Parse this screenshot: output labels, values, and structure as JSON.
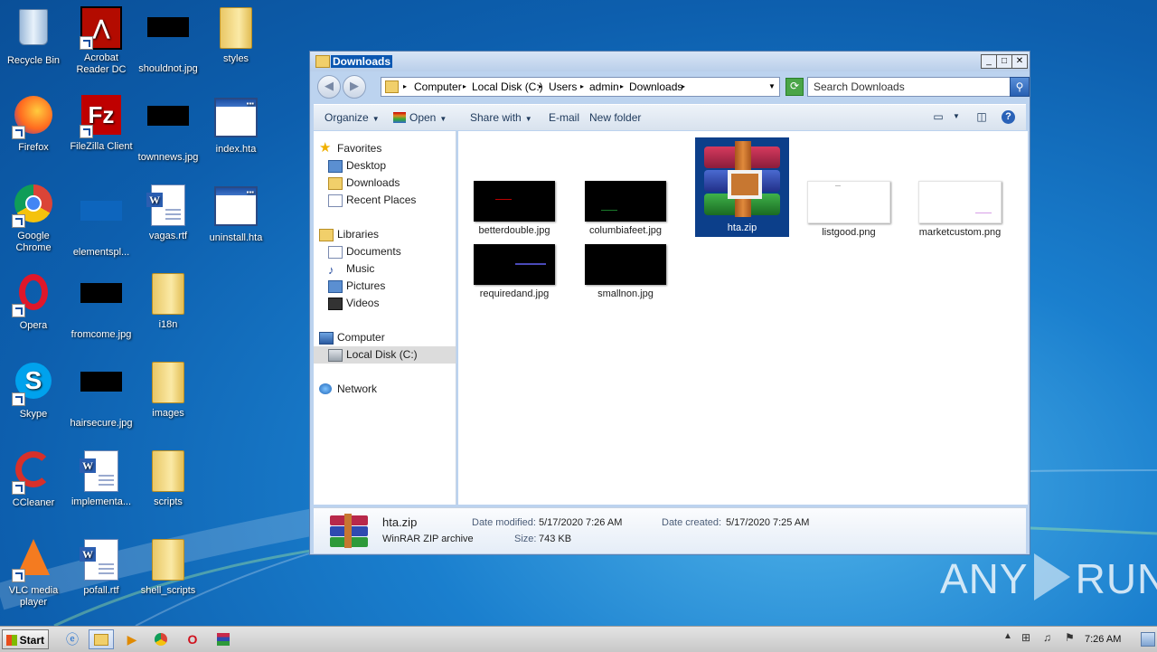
{
  "desktop": {
    "icons": [
      {
        "label": "Recycle Bin"
      },
      {
        "label": "Acrobat Reader DC"
      },
      {
        "label": "shouldnot.jpg"
      },
      {
        "label": "styles"
      },
      {
        "label": "Firefox"
      },
      {
        "label": "FileZilla Client"
      },
      {
        "label": "townnews.jpg"
      },
      {
        "label": "index.hta"
      },
      {
        "label": "Google Chrome"
      },
      {
        "label": "elementspl..."
      },
      {
        "label": "vagas.rtf"
      },
      {
        "label": "uninstall.hta"
      },
      {
        "label": "Opera"
      },
      {
        "label": "fromcome.jpg"
      },
      {
        "label": "i18n"
      },
      {
        "label": "Skype"
      },
      {
        "label": "hairsecure.jpg"
      },
      {
        "label": "images"
      },
      {
        "label": "CCleaner"
      },
      {
        "label": "implementa..."
      },
      {
        "label": "scripts"
      },
      {
        "label": "VLC media player"
      },
      {
        "label": "pofall.rtf"
      },
      {
        "label": "shell_scripts"
      }
    ]
  },
  "window": {
    "title": "Downloads",
    "controls": {
      "minimize": "_",
      "maximize": "□",
      "close": "✕"
    },
    "address": {
      "crumbs": [
        "Computer",
        "Local Disk (C:)",
        "Users",
        "admin",
        "Downloads"
      ],
      "search_placeholder": "Search Downloads"
    },
    "toolbar": {
      "organize": "Organize",
      "open": "Open",
      "share_with": "Share with",
      "email": "E-mail",
      "new_folder": "New folder"
    },
    "nav": {
      "favorites": "Favorites",
      "desktop": "Desktop",
      "downloads": "Downloads",
      "recent": "Recent Places",
      "libraries": "Libraries",
      "documents": "Documents",
      "music": "Music",
      "pictures": "Pictures",
      "videos": "Videos",
      "computer": "Computer",
      "local_disk": "Local Disk (C:)",
      "network": "Network"
    },
    "files": [
      {
        "name": "betterdouble.jpg"
      },
      {
        "name": "columbiafeet.jpg"
      },
      {
        "name": "hta.zip"
      },
      {
        "name": "listgood.png"
      },
      {
        "name": "marketcustom.png"
      },
      {
        "name": "requiredand.jpg"
      },
      {
        "name": "smallnon.jpg"
      }
    ],
    "details": {
      "name": "hta.zip",
      "type": "WinRAR ZIP archive",
      "modified_label": "Date modified:",
      "modified": "5/17/2020 7:26 AM",
      "created_label": "Date created:",
      "created": "5/17/2020 7:25 AM",
      "size_label": "Size:",
      "size": "743 KB"
    }
  },
  "taskbar": {
    "start": "Start",
    "clock": "7:26 AM"
  },
  "watermark": {
    "left": "ANY",
    "right": "RUN"
  }
}
